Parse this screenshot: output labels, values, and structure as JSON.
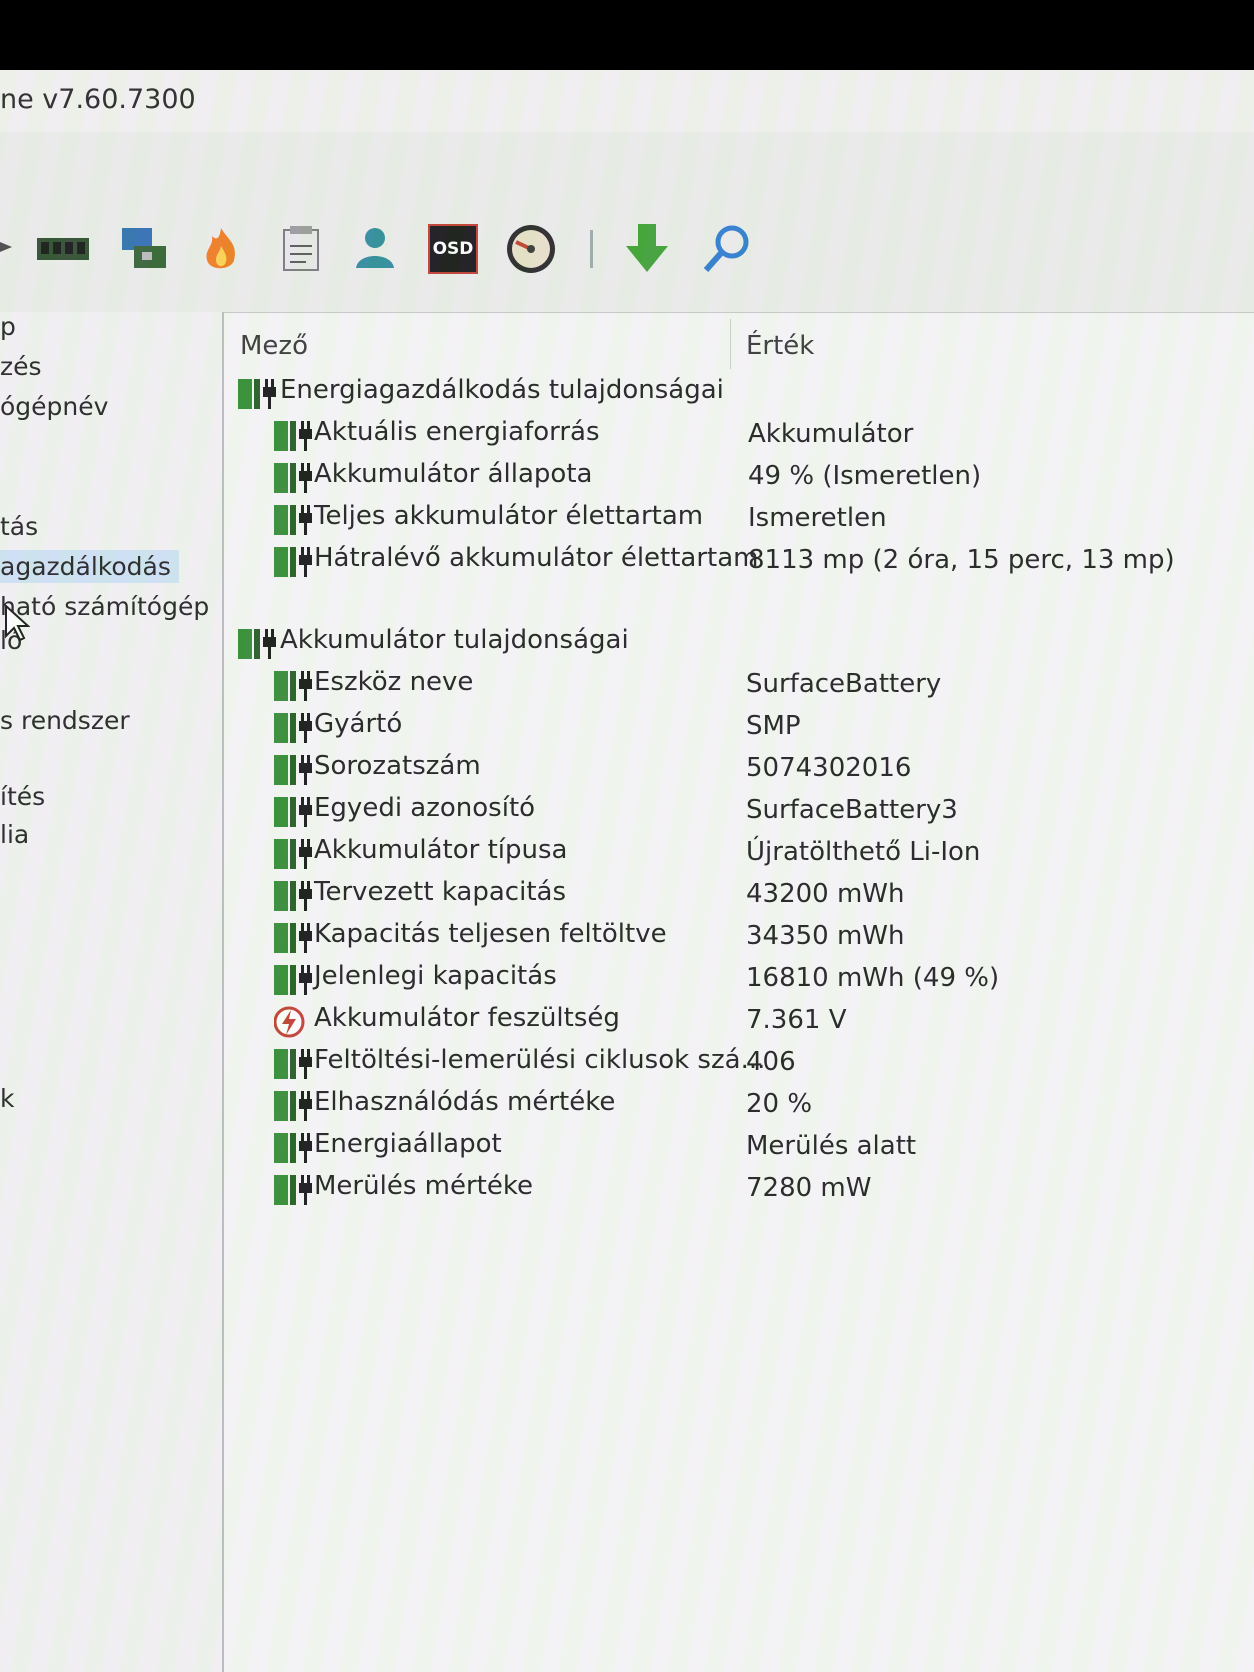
{
  "window": {
    "title": "ne v7.60.7300"
  },
  "toolbar": {
    "icons": [
      "arrow-icon",
      "memory-icon",
      "motherboard-icon",
      "flame-icon",
      "report-icon",
      "user-icon",
      "osd-icon",
      "gauge-icon",
      "download-icon",
      "search-icon"
    ],
    "osd_label": "OSD"
  },
  "sidebar": {
    "items": [
      {
        "label": "p"
      },
      {
        "label": "zés"
      },
      {
        "label": "ógépnév"
      },
      {
        "label": "tás"
      },
      {
        "label": "agazdálkodás"
      },
      {
        "label": "ható számítógép"
      },
      {
        "label": "ló"
      },
      {
        "label": "s rendszer"
      },
      {
        "label": "ítés"
      },
      {
        "label": "lia"
      },
      {
        "label": "k"
      }
    ]
  },
  "table": {
    "headers": {
      "field": "Mező",
      "value": "Érték"
    },
    "groups": [
      {
        "title": "Energiagazdálkodás tulajdonságai",
        "rows": [
          {
            "field": "Aktuális energiaforrás",
            "value": "Akkumulátor",
            "icon": "battery-plug-icon"
          },
          {
            "field": "Akkumulátor állapota",
            "value": "49 % (Ismeretlen)",
            "icon": "battery-plug-icon"
          },
          {
            "field": "Teljes akkumulátor élettartam",
            "value": "Ismeretlen",
            "icon": "battery-plug-icon"
          },
          {
            "field": "Hátralévő akkumulátor élettartam",
            "value": "8113 mp (2 óra, 15 perc, 13 mp)",
            "icon": "battery-plug-icon"
          }
        ]
      },
      {
        "title": "Akkumulátor tulajdonságai",
        "rows": [
          {
            "field": "Eszköz neve",
            "value": "SurfaceBattery",
            "icon": "battery-plug-icon"
          },
          {
            "field": "Gyártó",
            "value": "SMP",
            "icon": "battery-plug-icon"
          },
          {
            "field": "Sorozatszám",
            "value": "5074302016",
            "icon": "battery-plug-icon"
          },
          {
            "field": "Egyedi azonosító",
            "value": "SurfaceBattery3",
            "icon": "battery-plug-icon"
          },
          {
            "field": "Akkumulátor típusa",
            "value": "Újratölthető Li-Ion",
            "icon": "battery-plug-icon"
          },
          {
            "field": "Tervezett kapacitás",
            "value": "43200 mWh",
            "icon": "battery-plug-icon"
          },
          {
            "field": "Kapacitás teljesen feltöltve",
            "value": "34350 mWh",
            "icon": "battery-plug-icon"
          },
          {
            "field": "Jelenlegi kapacitás",
            "value": "16810 mWh  (49 %)",
            "icon": "battery-plug-icon"
          },
          {
            "field": "Akkumulátor feszültség",
            "value": "7.361 V",
            "icon": "voltage-icon"
          },
          {
            "field": "Feltöltési-lemerülési ciklusok szá...",
            "value": "406",
            "icon": "battery-plug-icon"
          },
          {
            "field": "Elhasználódás mértéke",
            "value": "20 %",
            "icon": "battery-plug-icon"
          },
          {
            "field": "Energiaállapot",
            "value": "Merülés alatt",
            "icon": "battery-plug-icon"
          },
          {
            "field": "Merülés mértéke",
            "value": "7280 mW",
            "icon": "battery-plug-icon"
          }
        ]
      }
    ]
  }
}
